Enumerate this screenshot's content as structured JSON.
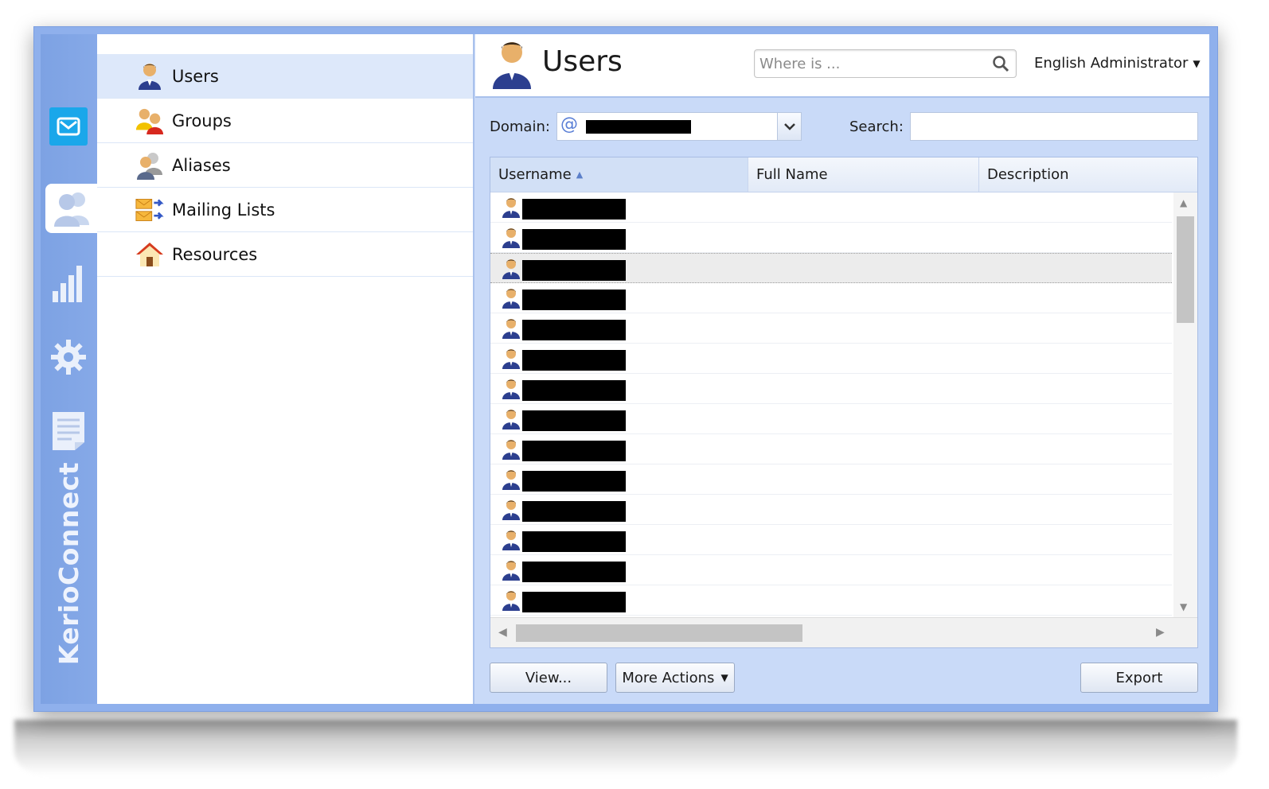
{
  "sidebar": {
    "brand": "KerioConnect",
    "rail": [
      "mail-icon",
      "users-icon",
      "statistics-icon",
      "settings-icon",
      "logs-icon"
    ]
  },
  "nav": {
    "items": [
      {
        "label": "Users",
        "icon": "user-icon",
        "active": true
      },
      {
        "label": "Groups",
        "icon": "groups-icon",
        "active": false
      },
      {
        "label": "Aliases",
        "icon": "aliases-icon",
        "active": false
      },
      {
        "label": "Mailing Lists",
        "icon": "mailing-lists-icon",
        "active": false
      },
      {
        "label": "Resources",
        "icon": "house-icon",
        "active": false
      }
    ]
  },
  "header": {
    "title": "Users",
    "search_placeholder": "Where is ...",
    "user_menu": "English Administrator"
  },
  "toolbar": {
    "domain_label": "Domain:",
    "search_label": "Search:",
    "search_value": ""
  },
  "grid": {
    "columns": [
      "Username",
      "Full Name",
      "Description"
    ],
    "sorted_column": "Username",
    "row_count": 14,
    "selected_row": 3
  },
  "actions": {
    "view": "View...",
    "more_actions": "More Actions",
    "export": "Export"
  },
  "colors": {
    "frame": "#8fb0ec",
    "rail": "#7da2e3",
    "panel": "#c9daf8",
    "active_nav": "#dde8fa",
    "mail_button": "#1aa7ea"
  }
}
